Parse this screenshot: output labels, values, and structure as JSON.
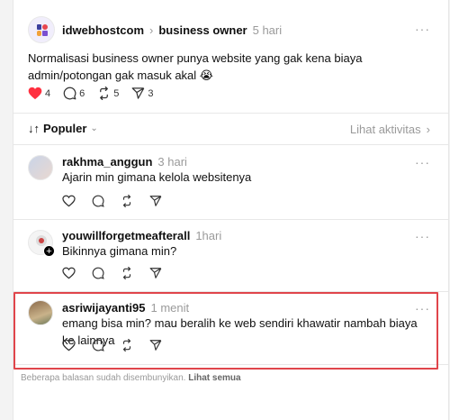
{
  "post": {
    "author": "idwebhostcom",
    "topic": "business owner",
    "time": "5 hari",
    "text": "Normalisasi business owner punya website yang gak kena biaya admin/potongan gak masuk akal 😭",
    "likes": "4",
    "comments": "6",
    "reposts": "5",
    "shares": "3"
  },
  "sort": {
    "label": "Populer",
    "activity_link": "Lihat aktivitas"
  },
  "replies": [
    {
      "author": "rakhma_anggun",
      "time": "3 hari",
      "text": "Ajarin min gimana kelola websitenya"
    },
    {
      "author": "youwillforgetmeafterall",
      "time": "1hari",
      "text": "Bikinnya gimana min?"
    },
    {
      "author": "asriwijayanti95",
      "time": "1 menit",
      "text": "emang bisa min? mau beralih ke web sendiri khawatir nambah biaya ke lainnya"
    }
  ],
  "footer": {
    "hidden_note": "Beberapa balasan sudah disembunyikan.",
    "see_all": "Lihat semua"
  },
  "colors": {
    "like_red": "#ff3040",
    "highlight": "#e0454b"
  }
}
